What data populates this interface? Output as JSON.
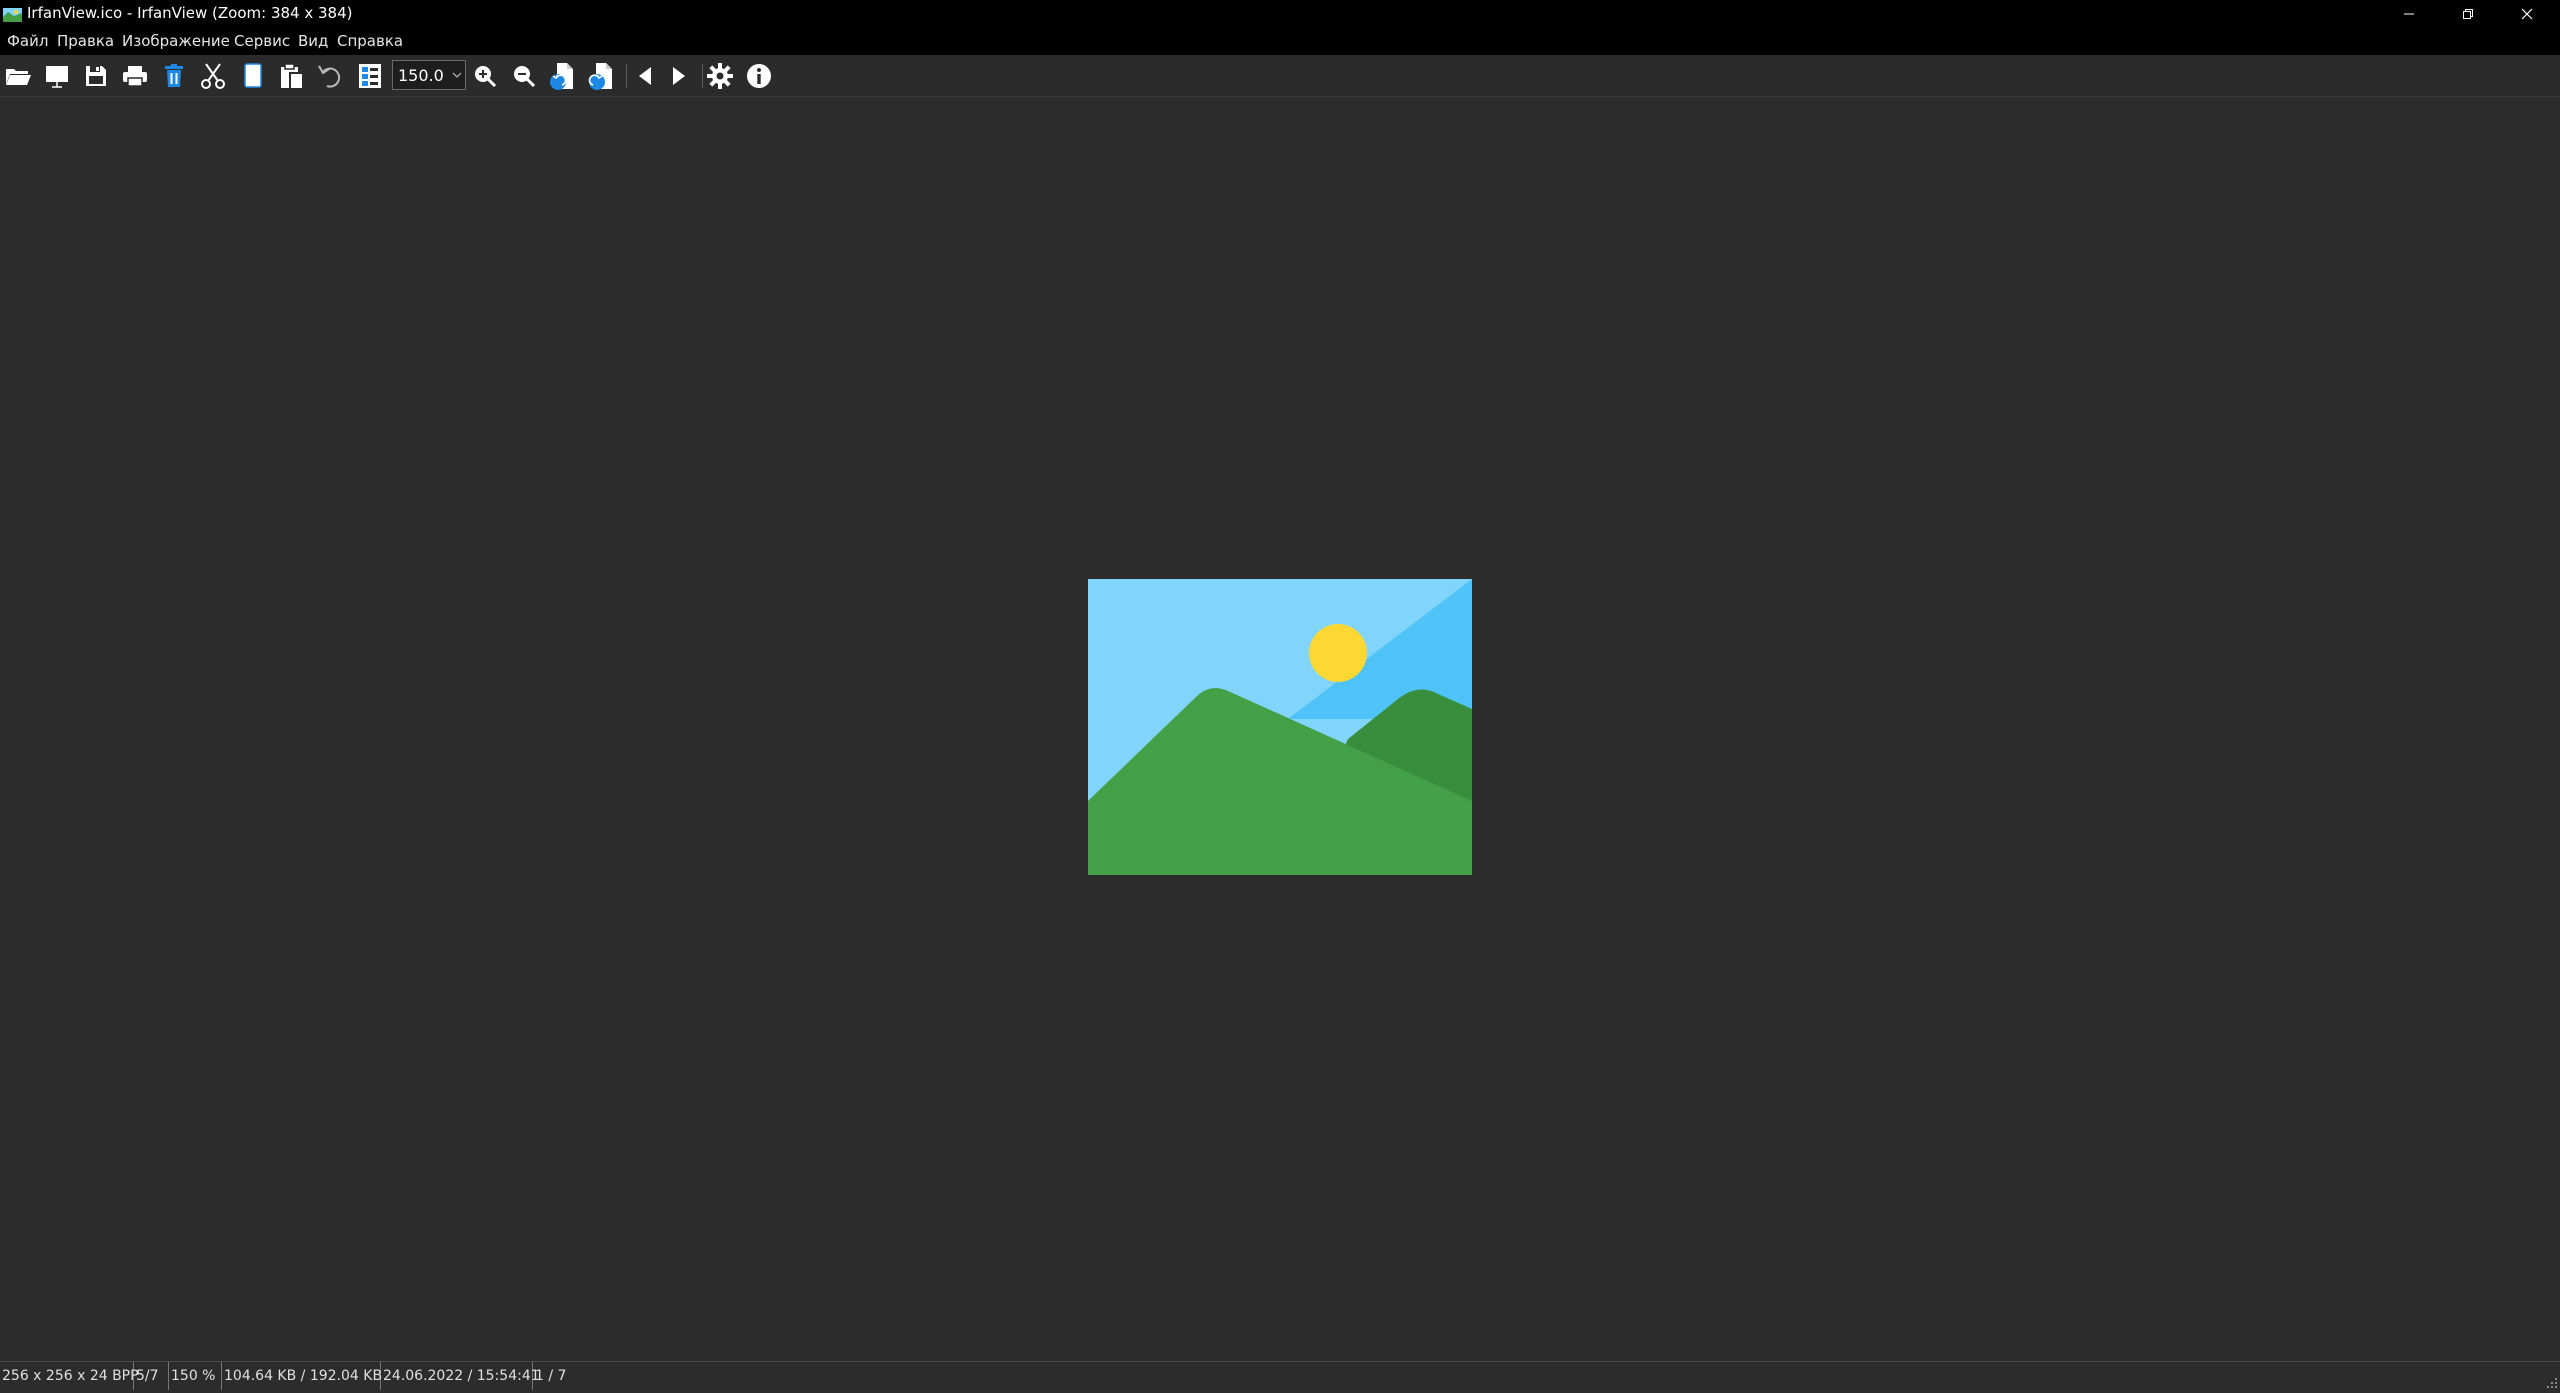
{
  "window": {
    "title": "IrfanView.ico - IrfanView (Zoom: 384 x 384)",
    "app_icon": "irfanview-app-icon",
    "controls": {
      "minimize_icon": "minimize-icon",
      "restore_icon": "restore-icon",
      "close_icon": "close-icon"
    }
  },
  "menu": {
    "items": [
      "Файл",
      "Правка",
      "Изображение",
      "Сервис",
      "Вид",
      "Справка"
    ]
  },
  "toolbar": {
    "buttons": [
      {
        "icon": "open-folder-icon"
      },
      {
        "icon": "slideshow-icon"
      },
      {
        "icon": "save-icon"
      },
      {
        "icon": "print-icon"
      },
      {
        "icon": "delete-icon"
      },
      {
        "icon": "cut-icon"
      },
      {
        "icon": "copy-icon"
      },
      {
        "icon": "paste-icon"
      },
      {
        "icon": "undo-icon"
      },
      {
        "icon": "thumbnails-icon"
      },
      {
        "icon": "zoom-in-icon"
      },
      {
        "icon": "zoom-out-icon"
      },
      {
        "icon": "rotate-left-icon"
      },
      {
        "icon": "rotate-right-icon"
      },
      {
        "icon": "previous-icon"
      },
      {
        "icon": "next-icon"
      },
      {
        "icon": "settings-icon"
      },
      {
        "icon": "info-icon"
      }
    ],
    "zoom_value": "150.0"
  },
  "image": {
    "description_icon": "landscape-image-icon",
    "colors": {
      "sky_light": "#81d4fa",
      "sky_dark": "#4fc3f7",
      "sun": "#fdd835",
      "hill_front": "#43a047",
      "hill_back": "#388e3c"
    }
  },
  "status": {
    "dimensions": "256 x 256 x 24 BPP",
    "page": "5/7",
    "zoom": "150 %",
    "size": "104.64 KB / 192.04 KB",
    "datetime": "24.06.2022 / 15:54:41",
    "index": "1 / 7"
  },
  "colors": {
    "titlebar": "#000000",
    "background": "#2c2c2c",
    "toolbar_accent": "#1e88e5"
  }
}
